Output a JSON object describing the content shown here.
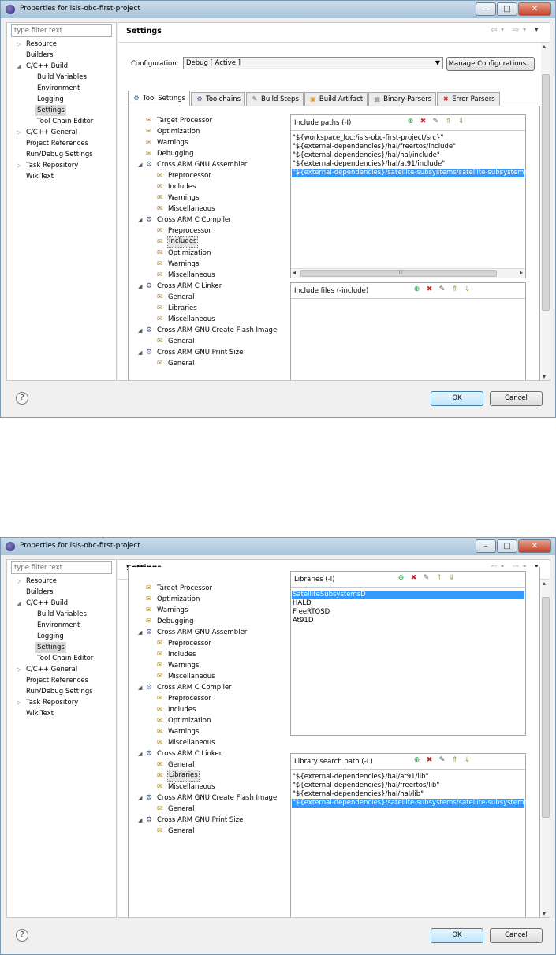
{
  "window_title": "Properties for isis-obc-first-project",
  "window_controls": {
    "minimize": "–",
    "maximize": "□",
    "close": "✕"
  },
  "filter_placeholder": "type filter text",
  "left_tree": [
    {
      "label": "Resource",
      "arrow": "▷"
    },
    {
      "label": "Builders"
    },
    {
      "label": "C/C++ Build",
      "arrow": "◢"
    },
    {
      "label": "Build Variables"
    },
    {
      "label": "Environment"
    },
    {
      "label": "Logging"
    },
    {
      "label": "Settings",
      "selected": true
    },
    {
      "label": "Tool Chain Editor"
    },
    {
      "label": "C/C++ General",
      "arrow": "▷"
    },
    {
      "label": "Project References"
    },
    {
      "label": "Run/Debug Settings"
    },
    {
      "label": "Task Repository",
      "arrow": "▷"
    },
    {
      "label": "WikiText"
    }
  ],
  "settings_title": "Settings",
  "nav_icons": [
    "⇦",
    "▾",
    "⇨",
    "▾",
    "▾"
  ],
  "configuration": {
    "label": "Configuration:",
    "value": "Debug  [ Active ]",
    "manage_button": "Manage Configurations..."
  },
  "tabs": [
    {
      "label": "Tool Settings",
      "icon": "gear-icon",
      "active": true
    },
    {
      "label": "Toolchains",
      "icon": "toolchain-icon"
    },
    {
      "label": "Build Steps",
      "icon": "build-steps-icon"
    },
    {
      "label": "Build Artifact",
      "icon": "build-artifact-icon"
    },
    {
      "label": "Binary Parsers",
      "icon": "binary-parsers-icon"
    },
    {
      "label": "Error Parsers",
      "icon": "error-parsers-icon"
    }
  ],
  "tool_tree": [
    {
      "label": "Target Processor",
      "icon": "folder-tool-icon"
    },
    {
      "label": "Optimization",
      "icon": "folder-tool-icon"
    },
    {
      "label": "Warnings",
      "icon": "folder-tool-icon"
    },
    {
      "label": "Debugging",
      "icon": "folder-tool-icon"
    },
    {
      "label": "Cross ARM GNU Assembler",
      "icon": "gear-icon",
      "expander": "◢"
    },
    {
      "label": "Preprocessor",
      "icon": "folder-tool-icon"
    },
    {
      "label": "Includes",
      "icon": "folder-tool-icon"
    },
    {
      "label": "Warnings",
      "icon": "folder-tool-icon"
    },
    {
      "label": "Miscellaneous",
      "icon": "folder-tool-icon"
    },
    {
      "label": "Cross ARM C Compiler",
      "icon": "gear-icon",
      "expander": "◢"
    },
    {
      "label": "Preprocessor",
      "icon": "folder-tool-icon"
    },
    {
      "label": "Includes",
      "icon": "folder-tool-icon"
    },
    {
      "label": "Optimization",
      "icon": "folder-tool-icon"
    },
    {
      "label": "Warnings",
      "icon": "folder-tool-icon"
    },
    {
      "label": "Miscellaneous",
      "icon": "folder-tool-icon"
    },
    {
      "label": "Cross ARM C Linker",
      "icon": "gear-icon",
      "expander": "◢"
    },
    {
      "label": "General",
      "icon": "folder-tool-icon"
    },
    {
      "label": "Libraries",
      "icon": "folder-tool-icon"
    },
    {
      "label": "Miscellaneous",
      "icon": "folder-tool-icon"
    },
    {
      "label": "Cross ARM GNU Create Flash Image",
      "icon": "gear-icon",
      "expander": "◢"
    },
    {
      "label": "General",
      "icon": "folder-tool-icon"
    },
    {
      "label": "Cross ARM GNU Print Size",
      "icon": "gear-icon",
      "expander": "◢"
    },
    {
      "label": "General",
      "icon": "folder-tool-icon"
    }
  ],
  "list_toolbar_icons": [
    "add-icon",
    "delete-icon",
    "edit-icon",
    "move-up-icon",
    "move-down-icon"
  ],
  "screens": [
    {
      "selected_tool_index": 11,
      "top_box": {
        "title": "Include paths (-I)",
        "items": [
          "\"${workspace_loc:/isis-obc-first-project/src}\"",
          "\"${external-dependencies}/hal/freertos/include\"",
          "\"${external-dependencies}/hal/hal/include\"",
          "\"${external-dependencies}/hal/at91/include\"",
          "\"${external-dependencies}/satellite-subsystems/satellite-subsystems/inc"
        ],
        "selected_index": 4,
        "hscroll_label": "III"
      },
      "bottom_box": {
        "title": "Include files (-include)",
        "items": []
      }
    },
    {
      "selected_tool_index": 17,
      "top_box": {
        "title": "Libraries (-l)",
        "items": [
          "SatelliteSubsystemsD",
          "HALD",
          "FreeRTOSD",
          "At91D"
        ],
        "selected_index": 0
      },
      "bottom_box": {
        "title": "Library search path (-L)",
        "items": [
          "\"${external-dependencies}/hal/at91/lib\"",
          "\"${external-dependencies}/hal/freertos/lib\"",
          "\"${external-dependencies}/hal/hal/lib\"",
          "\"${external-dependencies}/satellite-subsystems/satellite-subsystems/lib"
        ],
        "selected_index": 3
      }
    }
  ],
  "buttons": {
    "help": "?",
    "ok": "OK",
    "cancel": "Cancel"
  }
}
